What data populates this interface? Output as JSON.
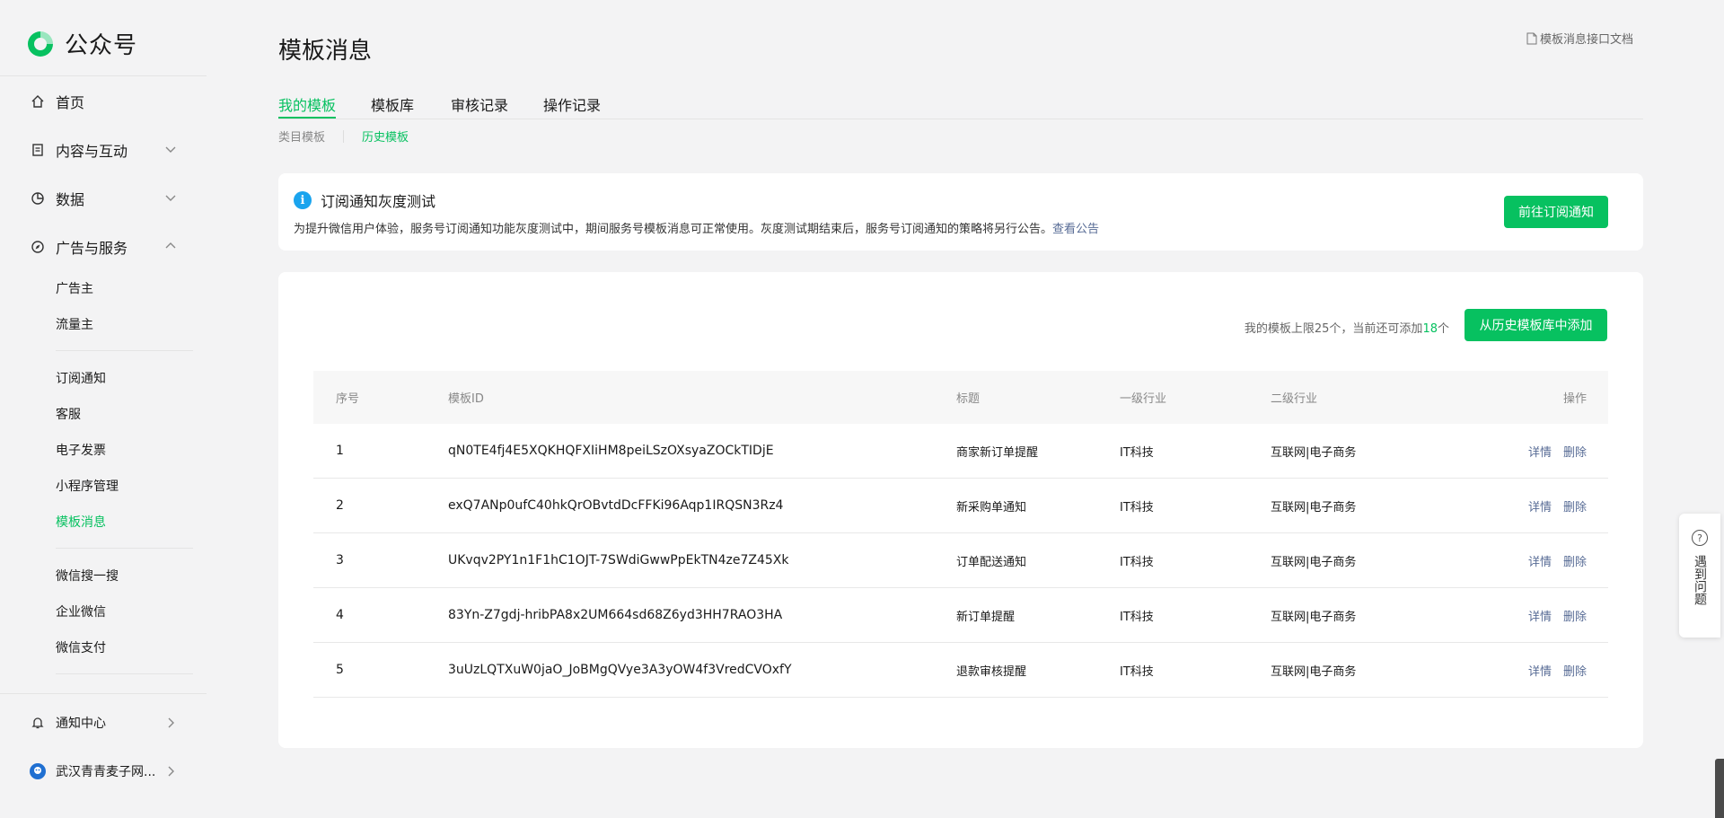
{
  "brand": {
    "name": "公众号",
    "accent": "#07c160"
  },
  "sidebar": {
    "home": "首页",
    "content": "内容与互动",
    "data": "数据",
    "ads": "广告与服务",
    "ads_items": [
      "广告主",
      "流量主"
    ],
    "service_items": [
      "订阅通知",
      "客服",
      "电子发票",
      "小程序管理",
      "模板消息"
    ],
    "other_items": [
      "微信搜一搜",
      "企业微信",
      "微信支付"
    ],
    "notify": "通知中心",
    "account": "武汉青青麦子网..."
  },
  "page": {
    "title": "模板消息",
    "doc_link": "模板消息接口文档",
    "tabs": [
      "我的模板",
      "模板库",
      "审核记录",
      "操作记录"
    ],
    "subtabs": [
      "类目模板",
      "历史模板"
    ]
  },
  "notice": {
    "title": "订阅通知灰度测试",
    "text": "为提升微信用户体验，服务号订阅通知功能灰度测试中，期间服务号模板消息可正常使用。灰度测试期结束后，服务号订阅通知的策略将另行公告。",
    "link": "查看公告",
    "button": "前往订阅通知"
  },
  "templates": {
    "limit_prefix": "我的模板上限25个，当前还可添加",
    "remaining": "18",
    "limit_suffix": "个",
    "add_button": "从历史模板库中添加",
    "columns": [
      "序号",
      "模板ID",
      "标题",
      "一级行业",
      "二级行业",
      "操作"
    ],
    "rows": [
      {
        "no": "1",
        "id": "qN0TE4fj4E5XQKHQFXIiHM8peiLSzOXsyaZOCkTIDjE",
        "title": "商家新订单提醒",
        "industry1": "IT科技",
        "industry2": "互联网|电子商务"
      },
      {
        "no": "2",
        "id": "exQ7ANp0ufC40hkQrOBvtdDcFFKi96Aqp1IRQSN3Rz4",
        "title": "新采购单通知",
        "industry1": "IT科技",
        "industry2": "互联网|电子商务"
      },
      {
        "no": "3",
        "id": "UKvqv2PY1n1F1hC1OJT-7SWdiGwwPpEkTN4ze7Z45Xk",
        "title": "订单配送通知",
        "industry1": "IT科技",
        "industry2": "互联网|电子商务"
      },
      {
        "no": "4",
        "id": "83Yn-Z7gdj-hribPA8x2UM664sd68Z6yd3HH7RAO3HA",
        "title": "新订单提醒",
        "industry1": "IT科技",
        "industry2": "互联网|电子商务"
      },
      {
        "no": "5",
        "id": "3uUzLQTXuW0jaO_JoBMgQVye3A3yOW4f3VredCVOxfY",
        "title": "退款审核提醒",
        "industry1": "IT科技",
        "industry2": "互联网|电子商务"
      }
    ],
    "op_detail": "详情",
    "op_delete": "删除"
  },
  "help": {
    "label": "遇到问题"
  }
}
